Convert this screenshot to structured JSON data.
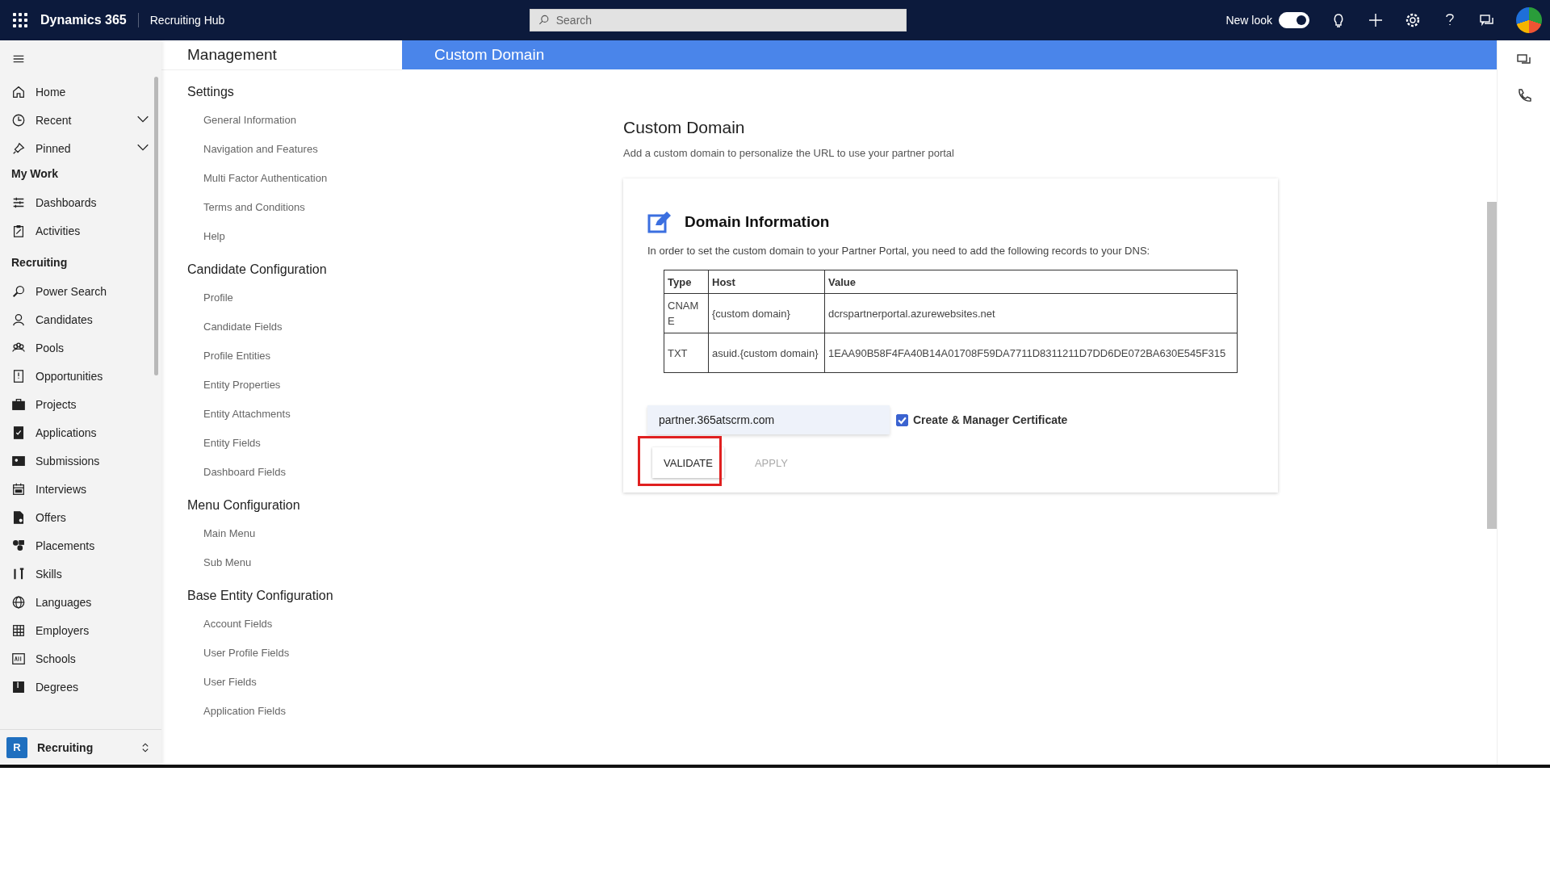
{
  "top_bar": {
    "app_name": "Dynamics 365",
    "area_name": "Recruiting Hub",
    "search": {
      "placeholder": "Search"
    },
    "new_look": {
      "label": "New look",
      "on": true
    }
  },
  "sidebar": {
    "sections": [
      {
        "items": [
          {
            "label": "Home",
            "kind": "link"
          },
          {
            "label": "Recent",
            "kind": "group",
            "expanded": false
          },
          {
            "label": "Pinned",
            "kind": "group",
            "expanded": false
          }
        ]
      },
      {
        "heading": "My Work",
        "items": [
          {
            "label": "Dashboards",
            "kind": "link"
          },
          {
            "label": "Activities",
            "kind": "link"
          }
        ]
      },
      {
        "heading": "Recruiting",
        "items": [
          {
            "label": "Power Search",
            "kind": "link"
          },
          {
            "label": "Candidates",
            "kind": "link"
          },
          {
            "label": "Pools",
            "kind": "link"
          },
          {
            "label": "Opportunities",
            "kind": "link"
          },
          {
            "label": "Projects",
            "kind": "link"
          },
          {
            "label": "Applications",
            "kind": "link"
          },
          {
            "label": "Submissions",
            "kind": "link"
          },
          {
            "label": "Interviews",
            "kind": "link"
          },
          {
            "label": "Offers",
            "kind": "link"
          },
          {
            "label": "Placements",
            "kind": "link"
          },
          {
            "label": "Skills",
            "kind": "link"
          },
          {
            "label": "Languages",
            "kind": "link"
          },
          {
            "label": "Employers",
            "kind": "link"
          },
          {
            "label": "Schools",
            "kind": "link"
          },
          {
            "label": "Degrees",
            "kind": "link"
          }
        ]
      }
    ],
    "area_switcher": {
      "initial": "R",
      "label": "Recruiting"
    }
  },
  "management": {
    "title": "Management",
    "groups": [
      {
        "heading": "Settings",
        "items": [
          "General Information",
          "Navigation and Features",
          "Multi Factor Authentication",
          "Terms and Conditions",
          "Help"
        ]
      },
      {
        "heading": "Candidate Configuration",
        "items": [
          "Profile",
          "Candidate Fields",
          "Profile Entities",
          "Entity Properties",
          "Entity Attachments",
          "Entity Fields",
          "Dashboard Fields"
        ]
      },
      {
        "heading": "Menu Configuration",
        "items": [
          "Main Menu",
          "Sub Menu"
        ]
      },
      {
        "heading": "Base Entity Configuration",
        "items": [
          "Account Fields",
          "User Profile Fields",
          "User Fields",
          "Application Fields"
        ]
      }
    ]
  },
  "page_header": {
    "title": "Custom Domain"
  },
  "content": {
    "title": "Custom Domain",
    "subtitle": "Add a custom domain to personalize the URL to use your partner portal",
    "card": {
      "title": "Domain Information",
      "description": "In order to set the custom domain to your Partner Portal, you need to add the following records to your DNS:",
      "table": {
        "columns": [
          "Type",
          "Host",
          "Value"
        ],
        "rows": [
          [
            "CNAME",
            "{custom domain}",
            "dcrspartnerportal.azurewebsites.net"
          ],
          [
            "TXT",
            "asuid.{custom domain}",
            "1EAA90B58F4FA40B14A01708F59DA7711D8311211D7DD6DE072BA630E545F315"
          ]
        ]
      },
      "domain_field": {
        "value": "partner.365atscrm.com"
      },
      "certificate": {
        "label": "Create & Manager Certificate",
        "checked": true
      },
      "buttons": [
        {
          "label": "VALIDATE",
          "disabled": false,
          "highlighted": true
        },
        {
          "label": "APPLY",
          "disabled": true,
          "highlighted": false
        }
      ]
    }
  }
}
